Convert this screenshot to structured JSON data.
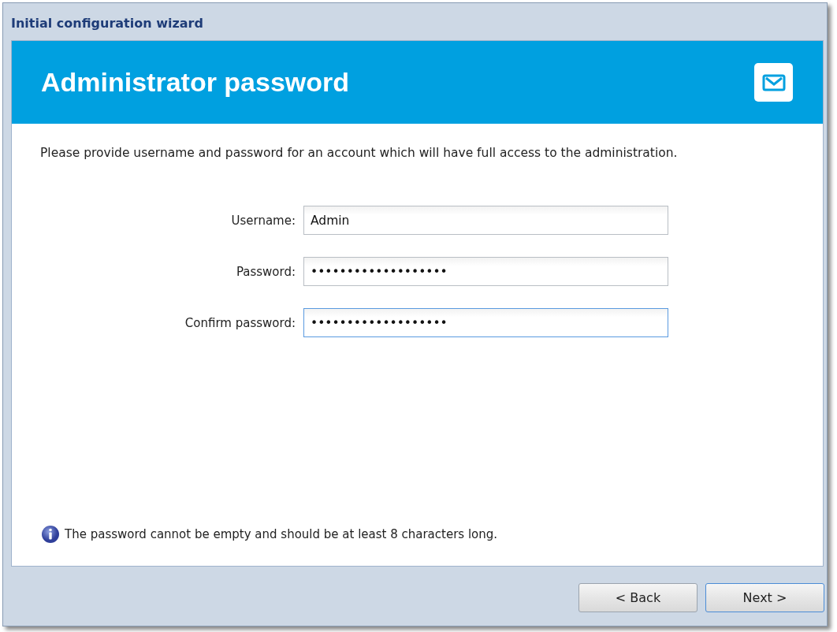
{
  "window": {
    "title": "Initial configuration wizard"
  },
  "header": {
    "title": "Administrator password"
  },
  "intro": "Please provide username and password for an account which will have full access to the administration.",
  "fields": [
    {
      "label": "Username:",
      "value": "Admin",
      "focused": false
    },
    {
      "label": "Password:",
      "value": "•••••••••••••••••••",
      "focused": false
    },
    {
      "label": "Confirm password:",
      "value": "•••••••••••••••••••",
      "focused": true
    }
  ],
  "hint": "The password cannot be empty and should be at least 8 characters long.",
  "buttons": [
    {
      "label": "< Back",
      "default": false
    },
    {
      "label": "Next >",
      "default": true
    }
  ]
}
